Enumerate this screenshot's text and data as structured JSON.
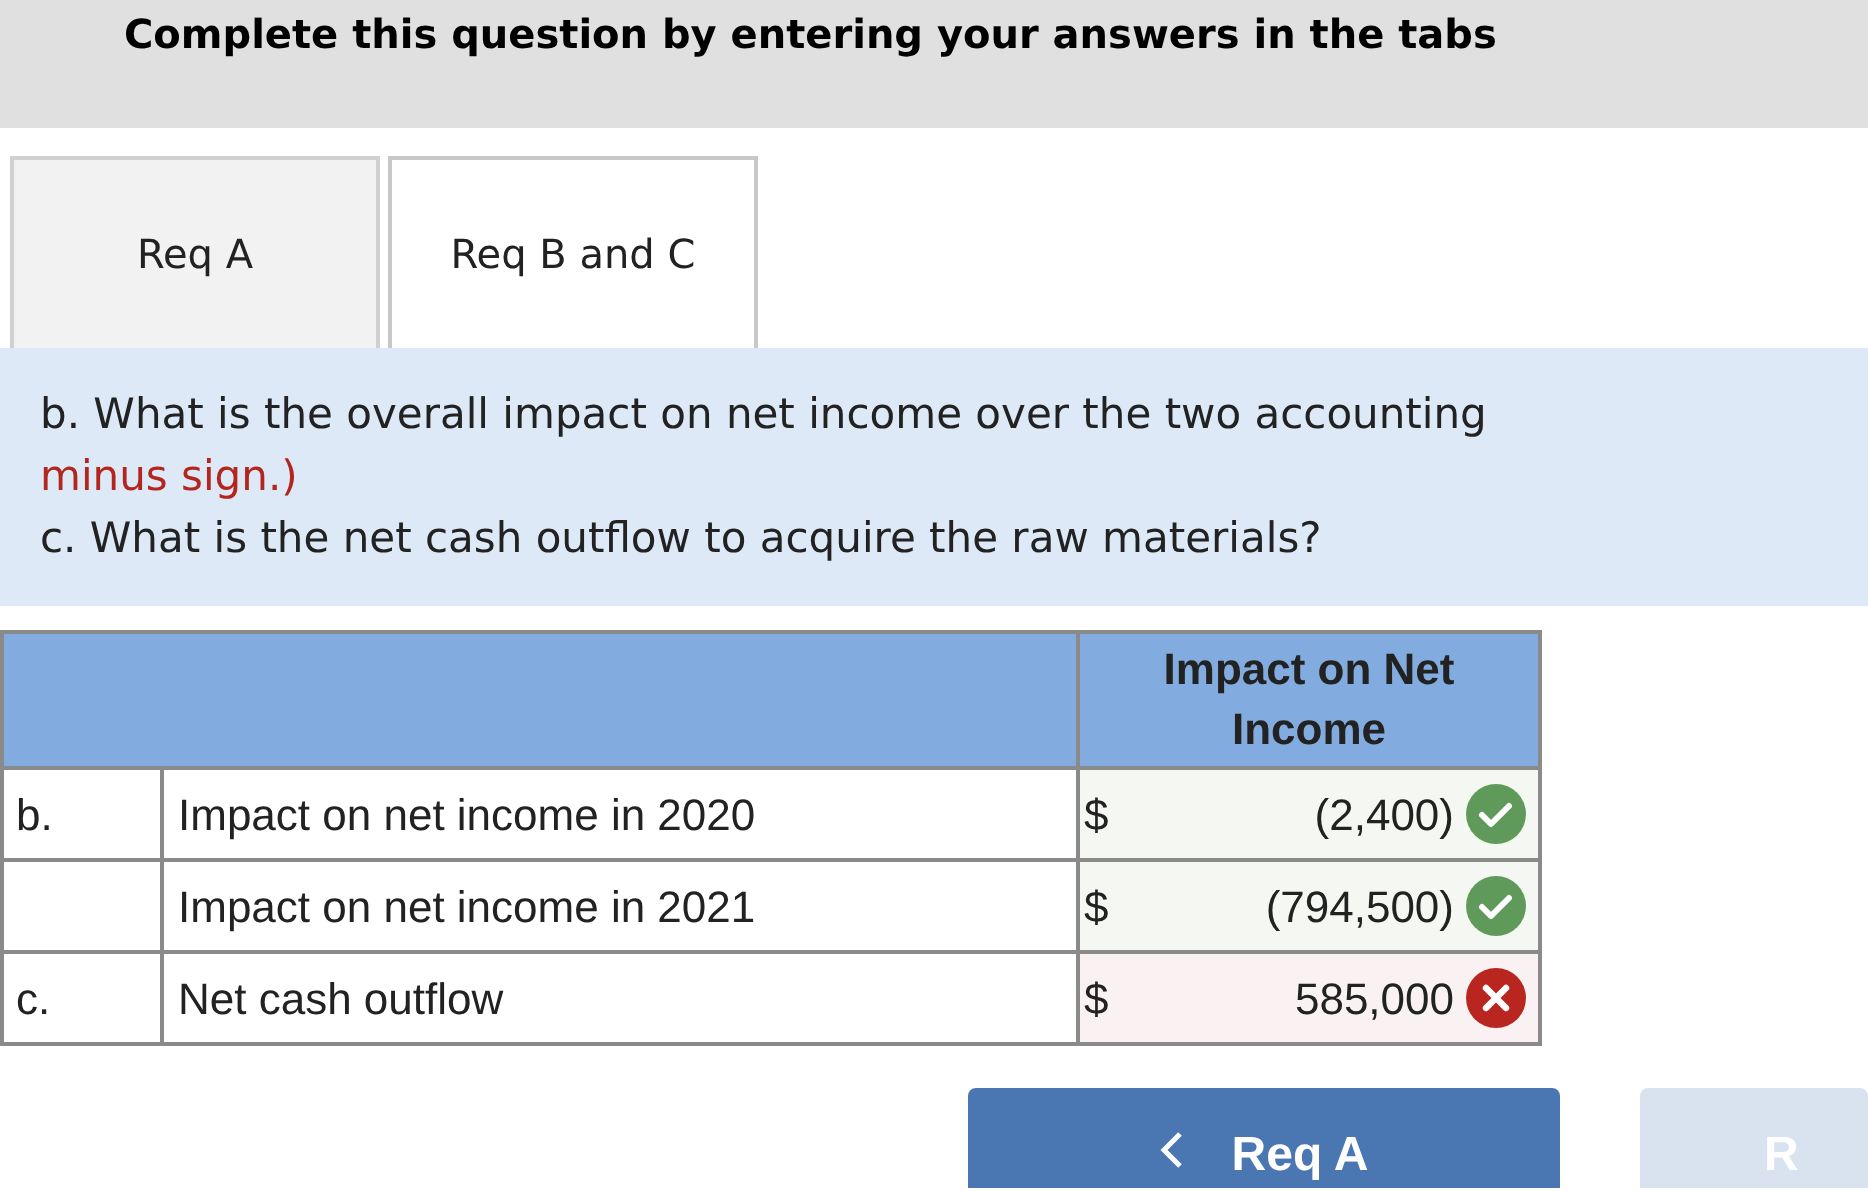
{
  "instruction": "Complete this question by entering your answers in the tabs",
  "tabs": [
    {
      "label": "Req A",
      "selected": false
    },
    {
      "label": "Req B and C",
      "selected": true
    }
  ],
  "question": {
    "lines": [
      {
        "text": "b. What is the overall impact on net income over the two accounting",
        "kind": "plain"
      },
      {
        "text": "minus sign.)",
        "kind": "note"
      },
      {
        "text": "c. What is the net cash outflow to acquire the raw materials?",
        "kind": "plain"
      }
    ]
  },
  "table": {
    "columns": [
      "Impact on Net Income"
    ],
    "rows": [
      {
        "letter": "b.",
        "label": "Impact on net income in 2020",
        "currency": "$",
        "value": "(2,400)",
        "correct": true
      },
      {
        "letter": "",
        "label": "Impact on net income in 2021",
        "currency": "$",
        "value": "(794,500)",
        "correct": true
      },
      {
        "letter": "c.",
        "label": "Net cash outflow",
        "currency": "$",
        "value": "585,000",
        "correct": false
      }
    ]
  },
  "nav": [
    {
      "label": "Req A",
      "kind": "prev",
      "disabled": false
    },
    {
      "label": "R",
      "kind": "next",
      "disabled": true
    }
  ]
}
